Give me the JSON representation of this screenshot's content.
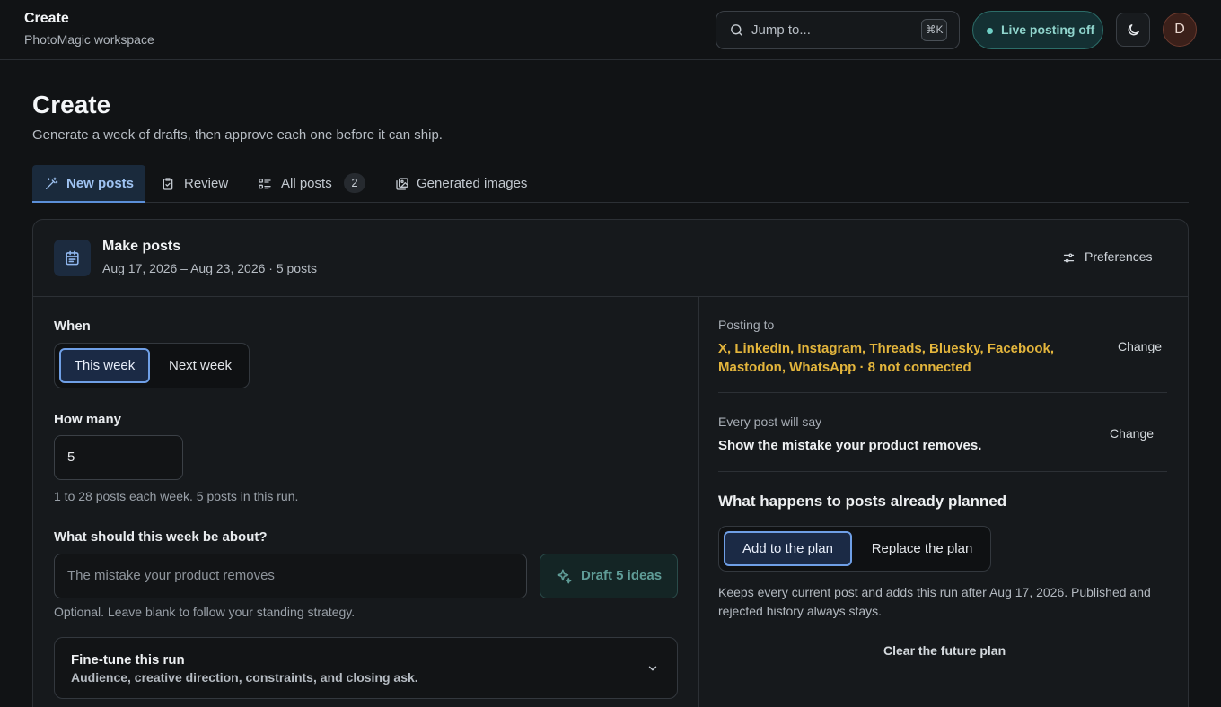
{
  "header": {
    "app_title": "Create",
    "workspace": "PhotoMagic workspace",
    "search_placeholder": "Jump to...",
    "search_shortcut": "⌘K",
    "live_status": "Live posting off",
    "avatar_initial": "D"
  },
  "page": {
    "title": "Create",
    "subtitle": "Generate a week of drafts, then approve each one before it can ship."
  },
  "tabs": [
    {
      "label": "New posts",
      "active": true
    },
    {
      "label": "Review"
    },
    {
      "label": "All posts",
      "badge": "2"
    },
    {
      "label": "Generated images"
    }
  ],
  "card": {
    "title": "Make posts",
    "subtitle": "Aug 17, 2026 – Aug 23, 2026 · 5 posts",
    "preferences_label": "Preferences"
  },
  "left": {
    "when_label": "When",
    "when_options": [
      "This week",
      "Next week"
    ],
    "when_selected": "This week",
    "how_many_label": "How many",
    "how_many_value": "5",
    "how_many_hint": "1 to 28 posts each week. 5 posts in this run.",
    "topic_label": "What should this week be about?",
    "topic_placeholder": "The mistake your product removes",
    "topic_hint": "Optional. Leave blank to follow your standing strategy.",
    "draft_button": "Draft 5 ideas",
    "finetune_title": "Fine-tune this run",
    "finetune_sub": "Audience, creative direction, constraints, and closing ask."
  },
  "right": {
    "posting_to_label": "Posting to",
    "platforms": "X, LinkedIn, Instagram, Threads, Bluesky, Facebook, Mastodon, WhatsApp · 8 not connected",
    "change_label": "Change",
    "every_post_label": "Every post will say",
    "every_post_value": "Show the mistake your product removes.",
    "planned_heading": "What happens to posts already planned",
    "plan_options": [
      "Add to the plan",
      "Replace the plan"
    ],
    "plan_selected": "Add to the plan",
    "plan_note": "Keeps every current post and adds this run after Aug 17, 2026. Published and rejected history always stays.",
    "clear_label": "Clear the future plan"
  },
  "colors": {
    "accent": "#6f9fe6",
    "warning": "#e3b53c",
    "live_teal": "#8fd4cc",
    "background": "#111315"
  }
}
